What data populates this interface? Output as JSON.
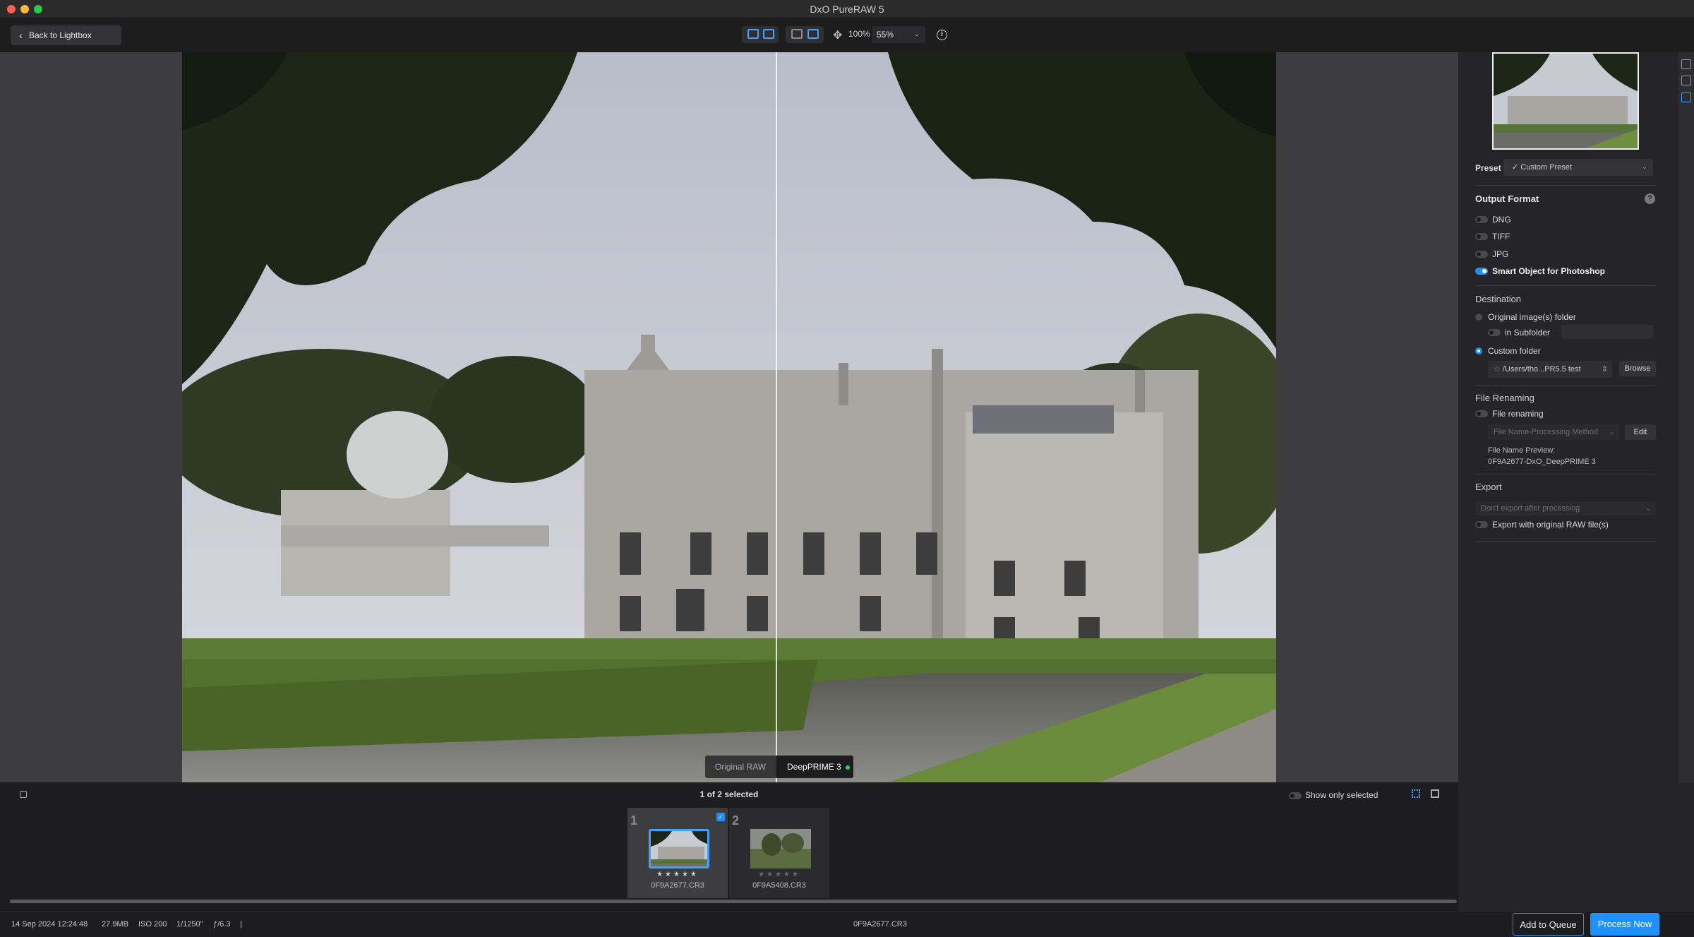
{
  "app": {
    "title": "DxO PureRAW 5"
  },
  "toolbar": {
    "back_label": "Back to Lightbox",
    "zoom_fit": "100%",
    "zoom_value": "55%"
  },
  "viewer": {
    "left_label": "Original RAW",
    "right_label": "DeepPRIME 3"
  },
  "sidebar": {
    "preset_label": "Preset",
    "preset_value": "Custom Preset",
    "output_format": {
      "heading": "Output Format",
      "help": "?",
      "options": [
        {
          "label": "DNG",
          "on": false
        },
        {
          "label": "TIFF",
          "on": false
        },
        {
          "label": "JPG",
          "on": false
        },
        {
          "label": "Smart Object for Photoshop",
          "on": true
        }
      ]
    },
    "destination": {
      "heading": "Destination",
      "original_folder": "Original image(s) folder",
      "in_subfolder": "in Subfolder",
      "custom_folder": "Custom folder",
      "custom_path": "/Users/tho...PR5.5 test",
      "browse": "Browse",
      "selected": "Custom folder"
    },
    "file_renaming": {
      "heading": "File Renaming",
      "toggle_label": "File renaming",
      "method_placeholder": "File Name-Processing Method",
      "edit": "Edit",
      "preview_label": "File Name Preview:",
      "preview_value": "0F9A2677-DxO_DeepPRIME 3"
    },
    "export": {
      "heading": "Export",
      "select_value": "Don't export after processing",
      "raw_toggle": "Export with original RAW file(s)"
    }
  },
  "filmstrip": {
    "selection_text": "1 of 2 selected",
    "show_only_selected": "Show only selected",
    "items": [
      {
        "index": "1",
        "name": "0F9A2677.CR3",
        "stars": "★★★★★",
        "selected": true
      },
      {
        "index": "2",
        "name": "0F9A5408.CR3",
        "stars": "★★★★★",
        "selected": false
      }
    ]
  },
  "status": {
    "date": "14 Sep 2024 12:24:48",
    "size": "27.9MB",
    "iso": "ISO 200",
    "shutter": "1/1250\"",
    "aperture": "ƒ/6.3",
    "divider": "|",
    "filename": "0F9A2677.CR3",
    "add_queue": "Add to Queue",
    "process_now": "Process Now"
  },
  "colors": {
    "accent": "#1f8fff",
    "process_button": "#1e90ff"
  }
}
